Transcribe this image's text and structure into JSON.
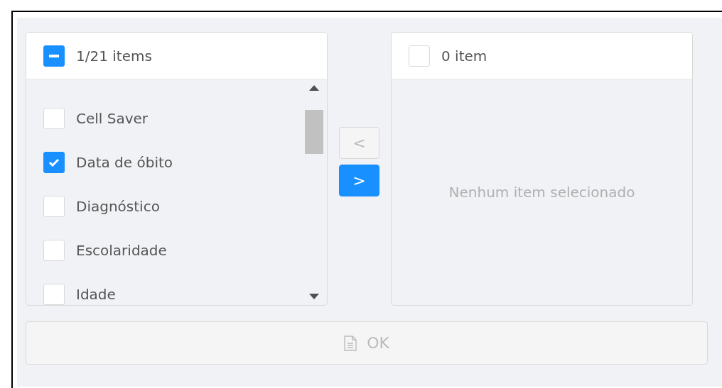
{
  "source": {
    "header": {
      "indeterminate": true,
      "count": "1/21 items"
    },
    "items": [
      {
        "label": "Cell Saver",
        "checked": false
      },
      {
        "label": "Data de óbito",
        "checked": true
      },
      {
        "label": "Diagnóstico",
        "checked": false
      },
      {
        "label": "Escolaridade",
        "checked": false
      },
      {
        "label": "Idade",
        "checked": false
      }
    ]
  },
  "transfer": [
    {
      "label": "<",
      "disabled": true
    },
    {
      "label": ">",
      "disabled": false
    }
  ],
  "target": {
    "header": {
      "indeterminate": false,
      "count": "0 item"
    },
    "empty": "Nenhum item selecionado"
  },
  "ok_button": {
    "label": "OK",
    "disabled": true
  }
}
